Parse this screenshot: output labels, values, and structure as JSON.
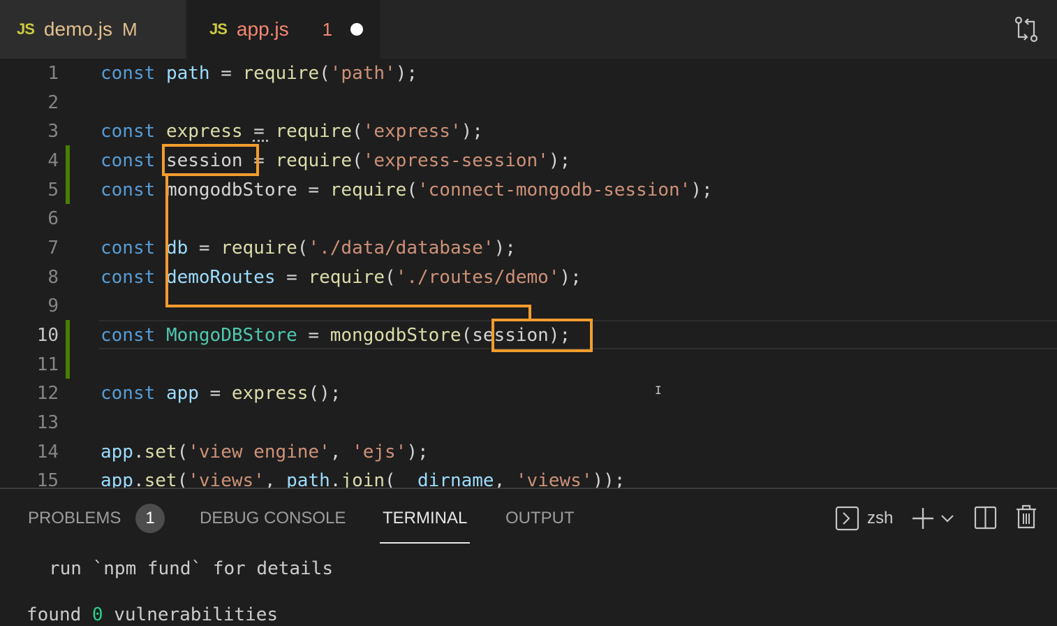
{
  "tabs": [
    {
      "icon": "JS",
      "name": "demo.js",
      "status": "M"
    },
    {
      "icon": "JS",
      "name": "app.js",
      "problems": "1",
      "unsaved": true
    }
  ],
  "editor": {
    "lines": [
      {
        "n": "1",
        "tokens": [
          [
            "kw",
            "const"
          ],
          [
            "pn",
            " "
          ],
          [
            "var",
            "path"
          ],
          [
            "pn",
            " = "
          ],
          [
            "fn",
            "require"
          ],
          [
            "pn",
            "("
          ],
          [
            "str",
            "'path'"
          ],
          [
            "pn",
            ");"
          ]
        ]
      },
      {
        "n": "2",
        "tokens": []
      },
      {
        "n": "3",
        "tokens": [
          [
            "kw",
            "const"
          ],
          [
            "pn",
            " "
          ],
          [
            "fn",
            "express"
          ],
          [
            "pn",
            " = "
          ],
          [
            "fn",
            "require"
          ],
          [
            "pn",
            "("
          ],
          [
            "str",
            "'express'"
          ],
          [
            "pn",
            ");"
          ]
        ]
      },
      {
        "n": "4",
        "tokens": [
          [
            "kw",
            "const"
          ],
          [
            "pn",
            " "
          ],
          [
            "pn",
            "session"
          ],
          [
            "pn",
            " = "
          ],
          [
            "fn",
            "require"
          ],
          [
            "pn",
            "("
          ],
          [
            "str",
            "'express-session'"
          ],
          [
            "pn",
            ");"
          ]
        ]
      },
      {
        "n": "5",
        "tokens": [
          [
            "kw",
            "const"
          ],
          [
            "pn",
            " "
          ],
          [
            "pn",
            "mongodbStore"
          ],
          [
            "pn",
            " = "
          ],
          [
            "fn",
            "require"
          ],
          [
            "pn",
            "("
          ],
          [
            "str",
            "'connect-mongodb-session'"
          ],
          [
            "pn",
            ");"
          ]
        ]
      },
      {
        "n": "6",
        "tokens": []
      },
      {
        "n": "7",
        "tokens": [
          [
            "kw",
            "const"
          ],
          [
            "pn",
            " "
          ],
          [
            "var",
            "db"
          ],
          [
            "pn",
            " = "
          ],
          [
            "fn",
            "require"
          ],
          [
            "pn",
            "("
          ],
          [
            "str",
            "'./data/database'"
          ],
          [
            "pn",
            ");"
          ]
        ]
      },
      {
        "n": "8",
        "tokens": [
          [
            "kw",
            "const"
          ],
          [
            "pn",
            " "
          ],
          [
            "var",
            "demoRoutes"
          ],
          [
            "pn",
            " = "
          ],
          [
            "fn",
            "require"
          ],
          [
            "pn",
            "("
          ],
          [
            "str",
            "'./routes/demo'"
          ],
          [
            "pn",
            ");"
          ]
        ]
      },
      {
        "n": "9",
        "tokens": []
      },
      {
        "n": "10",
        "tokens": [
          [
            "kw",
            "const"
          ],
          [
            "pn",
            " "
          ],
          [
            "cls",
            "MongoDBStore"
          ],
          [
            "pn",
            " = "
          ],
          [
            "fn",
            "mongodbStore"
          ],
          [
            "pn",
            "("
          ],
          [
            "pn",
            "session"
          ],
          [
            "pn",
            ");"
          ]
        ]
      },
      {
        "n": "11",
        "tokens": []
      },
      {
        "n": "12",
        "tokens": [
          [
            "kw",
            "const"
          ],
          [
            "pn",
            " "
          ],
          [
            "var",
            "app"
          ],
          [
            "pn",
            " = "
          ],
          [
            "fn",
            "express"
          ],
          [
            "pn",
            "();"
          ]
        ]
      },
      {
        "n": "13",
        "tokens": []
      },
      {
        "n": "14",
        "tokens": [
          [
            "var",
            "app"
          ],
          [
            "pn",
            "."
          ],
          [
            "fn",
            "set"
          ],
          [
            "pn",
            "("
          ],
          [
            "str",
            "'view engine'"
          ],
          [
            "pn",
            ", "
          ],
          [
            "str",
            "'ejs'"
          ],
          [
            "pn",
            ");"
          ]
        ]
      },
      {
        "n": "15",
        "tokens": [
          [
            "var",
            "app"
          ],
          [
            "pn",
            "."
          ],
          [
            "fn",
            "set"
          ],
          [
            "pn",
            "("
          ],
          [
            "str",
            "'views'"
          ],
          [
            "pn",
            ", "
          ],
          [
            "var",
            "path"
          ],
          [
            "pn",
            "."
          ],
          [
            "fn",
            "join"
          ],
          [
            "pn",
            "("
          ],
          [
            "var",
            "__dirname"
          ],
          [
            "pn",
            ", "
          ],
          [
            "str",
            "'views'"
          ],
          [
            "pn",
            "));"
          ]
        ]
      }
    ]
  },
  "panel": {
    "tabs": {
      "problems": "PROBLEMS",
      "problems_count": "1",
      "debug_console": "DEBUG CONSOLE",
      "terminal": "TERMINAL",
      "output": "OUTPUT"
    },
    "shell": "zsh",
    "terminal_lines": {
      "line1": "run `npm fund` for details",
      "line2_prefix": "found ",
      "line2_count": "0",
      "line2_suffix": " vulnerabilities"
    }
  },
  "colors": {
    "highlight_box": "#f39c2e",
    "gutter_modified": "#487e02"
  }
}
